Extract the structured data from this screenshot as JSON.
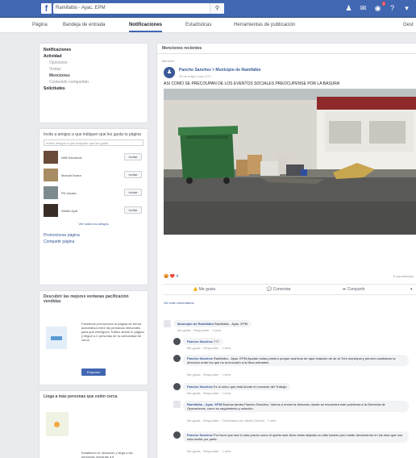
{
  "topbar": {
    "logo": "f",
    "search_text": "Ramifalbo - Ayac. EPM",
    "search_icon": "magnifier-icon",
    "notification_badge": "3"
  },
  "nav": {
    "items": [
      "Página",
      "Bandeja de entrada",
      "Notificaciones",
      "Estadísticas",
      "Herramientas de publicación"
    ],
    "right": "Gest"
  },
  "sidebar": {
    "menu": [
      {
        "label": "Notificaciones",
        "kind": "head"
      },
      {
        "label": "Actividad",
        "kind": "head"
      },
      {
        "label": "Opiniones",
        "kind": "sub"
      },
      {
        "label": "Visitas",
        "kind": "sub"
      },
      {
        "label": "Menciones",
        "kind": "sel"
      },
      {
        "label": "Contenido compartido",
        "kind": "sub"
      },
      {
        "label": "Solicitudes",
        "kind": "head"
      }
    ],
    "invite": {
      "title": "Invita a amigos a que indiquen que les gusta tu página",
      "search_placeholder": "Invitar amigos a que indiquen que les gusta",
      "friends": [
        {
          "name": "Wilfi Sandoval",
          "button": "Invitar"
        },
        {
          "name": "Manuel Ibarra",
          "button": "Invitar"
        },
        {
          "name": "Pili Zavala",
          "button": "Invitar"
        },
        {
          "name": "Walter Ayal",
          "button": "Invitar"
        }
      ],
      "see_all": "Ver todos los amigos"
    },
    "links": [
      "Promocionar página",
      "Compartir página"
    ],
    "promo": {
      "title": "Descubrir las mejores ventanas pacificación vendidas",
      "text": "Facebook promociona tu página de forma automática entre las personas relevantes para que entreguen Tráfico desde tu página y llegue a 2 personas de la comunidad de cerca",
      "button": "Empezar"
    },
    "reach": {
      "title": "Llega a más personas que estén cerca",
      "text": "Establecer tu ubicación y llega a las personas cercanas a ti"
    }
  },
  "main": {
    "section_title": "Menciones recientes",
    "post": {
      "tag": "Mención",
      "author": "Pancho Sanchez > Municipio de Ramifalbo",
      "time": "20 de mayo a las 1:17 · ",
      "text": "ASI COMO SE PRECOUPAN DE LOS EVENTOS SOCIALES PREOCUPENSE POR LA BASURA",
      "reactions": "😡 ❤️ 4",
      "comments_count": "5 comentarios",
      "actions": [
        "Me gusta",
        "Comentar",
        "Compartir"
      ],
      "view_more": "Ver más comentarios"
    },
    "comments": [
      {
        "name": "Municipio de Ramifalbo",
        "text": "Ramifalbo - Ayac. EPM",
        "meta": "Me gusta · Responder · 1 sem"
      },
      {
        "name": "Pancho Sanchez",
        "text": "???",
        "meta": "Me gusta · Responder · 1 sem"
      },
      {
        "name": "Pancho Sanchez",
        "text": "Ramifalbo - Ayac. EPM Ayudan todas primero porque acá tiran de aquí estación de de la Tres municipal y primero cambiaron la dirección entre los que no la encontró a la Nina entrantes",
        "meta": "Me gusta · Responder · 1 sem"
      },
      {
        "name": "Pancho Sanchez",
        "text": "Es lo único que está donde el convenio del Trabajo",
        "meta": "Me gusta · Responder · 1 sem"
      },
      {
        "name": "Ramifalbo - Ayac. EPM",
        "text": "Buenas tardes Pancho Sanchez, Vamos a enviar la dirección donde se encuentra este problema a la Gerencia de Operaciones, como su seguimiento y solución.",
        "meta": "Me gusta · Responder · Comentado por Alicia Chimbó · 1 sem"
      },
      {
        "name": "Pancho Sanchez",
        "text": "Por favor que sea lo más pronto como el quinto este lleno están dejando su sitio barrido pero están devolviendo en los mes que uno esta recibir por parte",
        "meta": "Me gusta · Responder · 1 sem"
      }
    ]
  },
  "colors": {
    "brand": "#4267b2",
    "link": "#385898",
    "background": "#e9ebee"
  }
}
